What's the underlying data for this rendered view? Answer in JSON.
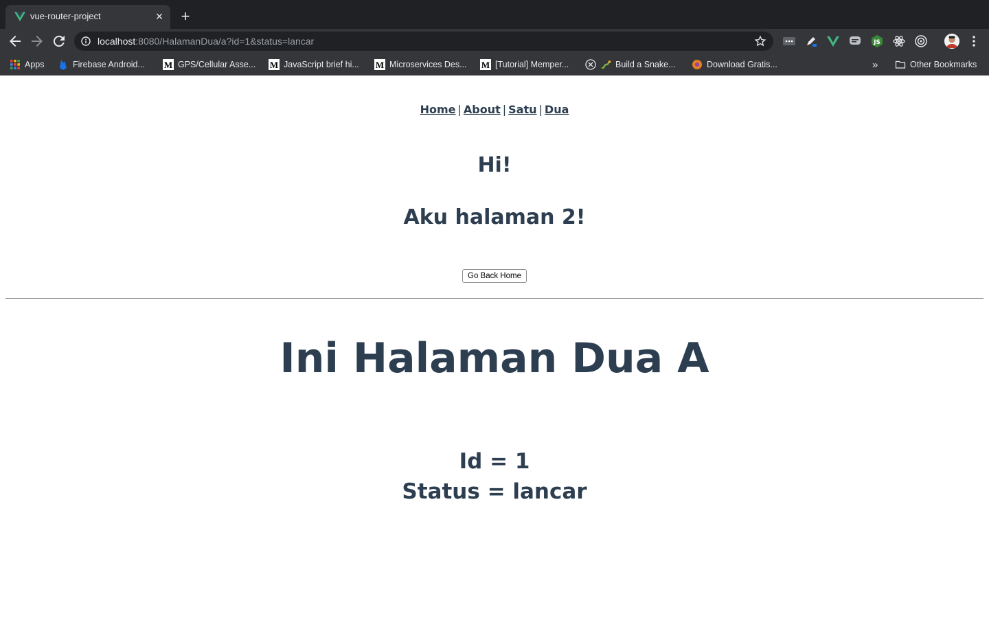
{
  "browser": {
    "tab": {
      "title": "vue-router-project",
      "close": "×"
    },
    "new_tab": "+",
    "url": {
      "host": "localhost",
      "rest": ":8080/HalamanDua/a?id=1&status=lancar"
    },
    "bookmarks": [
      {
        "label": "Apps",
        "icon": "apps-grid-icon"
      },
      {
        "label": "Firebase Android...",
        "icon": "firebase-icon"
      },
      {
        "label": "GPS/Cellular Asse...",
        "icon": "medium-icon"
      },
      {
        "label": "JavaScript brief hi...",
        "icon": "medium-icon"
      },
      {
        "label": "Microservices Des...",
        "icon": "medium-icon"
      },
      {
        "label": "[Tutorial] Memper...",
        "icon": "medium-icon"
      },
      {
        "label": "Build a Snake...",
        "icon": "snake-icon"
      },
      {
        "label": "Download Gratis...",
        "icon": "download-icon"
      }
    ],
    "overflow": "»",
    "other_bookmarks": "Other Bookmarks"
  },
  "page": {
    "nav": {
      "home": "Home",
      "about": "About",
      "satu": "Satu",
      "dua": "Dua",
      "separator": "|"
    },
    "greeting": "Hi!",
    "subtitle": "Aku halaman 2!",
    "back_button": "Go Back Home",
    "title": "Ini Halaman Dua A",
    "id_line": "Id = 1",
    "status_line": "Status = lancar"
  },
  "colors": {
    "text": "#2c3e50",
    "chrome_dark": "#202124",
    "chrome": "#35363a",
    "vue_green": "#41b883"
  }
}
